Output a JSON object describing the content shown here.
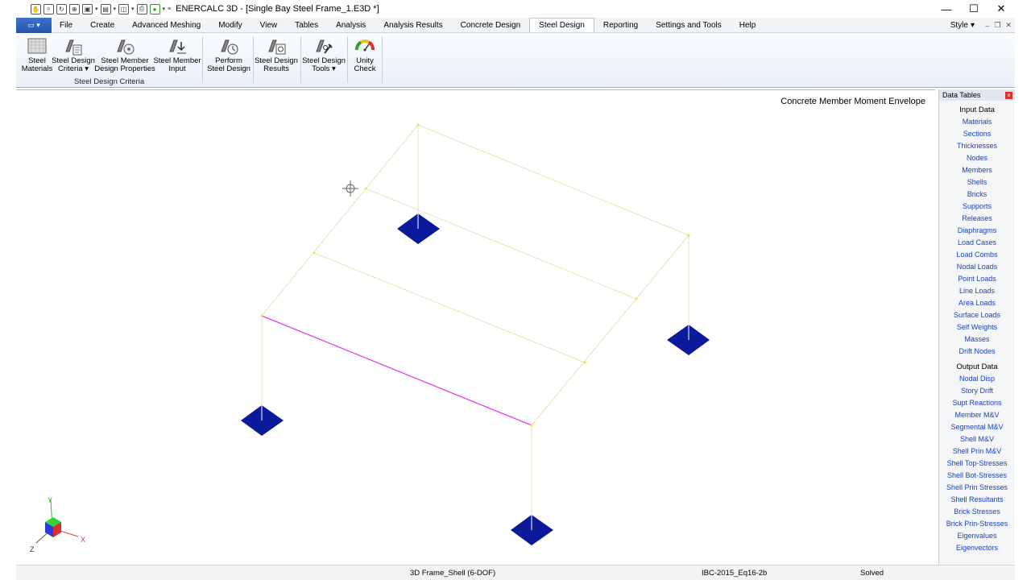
{
  "title_bar": {
    "title": "ENERCALC 3D - [Single Bay Steel Frame_1.E3D *]",
    "minimize": "—",
    "maximize": "☐",
    "close": "✕"
  },
  "menu": {
    "app_button": "▭ ▾",
    "tabs": [
      "File",
      "Create",
      "Advanced Meshing",
      "Modify",
      "View",
      "Tables",
      "Analysis",
      "Analysis Results",
      "Concrete Design",
      "Steel Design",
      "Reporting",
      "Settings and Tools",
      "Help"
    ],
    "active_tab": "Steel Design",
    "style_label": "Style",
    "style_arrow": "▾",
    "mini_min": "–",
    "mini_restore": "❐",
    "mini_close": "✕"
  },
  "ribbon": {
    "buttons": [
      {
        "line1": "Steel",
        "line2": "Materials"
      },
      {
        "line1": "Steel Design",
        "line2": "Criteria ▾"
      },
      {
        "line1": "Steel Member",
        "line2": "Design Properties"
      },
      {
        "line1": "Steel Member",
        "line2": "Input"
      },
      {
        "line1": "Perform",
        "line2": "Steel Design"
      },
      {
        "line1": "Steel Design",
        "line2": "Results"
      },
      {
        "line1": "Steel Design",
        "line2": "Tools ▾"
      },
      {
        "line1": "Unity",
        "line2": "Check"
      }
    ],
    "group_label": "Steel Design Criteria"
  },
  "viewport": {
    "title": "Concrete Member Moment Envelope",
    "axis_x": "X",
    "axis_y": "Y",
    "axis_z": "Z"
  },
  "data_tables": {
    "title": "Data Tables",
    "close": "x",
    "input_header": "Input Data",
    "input_items": [
      "Materials",
      "Sections",
      "Thicknesses",
      "Nodes",
      "Members",
      "Shells",
      "Bricks",
      "Supports",
      "Releases",
      "Diaphragms",
      "Load Cases",
      "Load Combs",
      "Nodal Loads",
      "Point Loads",
      "Line Loads",
      "Area Loads",
      "Surface Loads",
      "Self Weights",
      "Masses",
      "Drift Nodes"
    ],
    "output_header": "Output Data",
    "output_items": [
      "Nodal Disp",
      "Story Drift",
      "Supt Reactions",
      "Member M&V",
      "Segmental M&V",
      "Shell M&V",
      "Shell Prin M&V",
      "Shell Top-Stresses",
      "Shell Bot-Stresses",
      "Shell Prin Stresses",
      "Shell Resultants",
      "Brick Stresses",
      "Brick Prin-Stresses",
      "Eigenvalues",
      "Eigenvectors"
    ]
  },
  "status_bar": {
    "model_type": "3D Frame_Shell (6-DOF)",
    "load_combo": "IBC-2015_Eq16-2b",
    "state": "Solved"
  },
  "colors": {
    "support": "#0a1a9a",
    "highlight_member": "#e040e0",
    "member": "#e6e6b0",
    "node": "#e8e840"
  }
}
